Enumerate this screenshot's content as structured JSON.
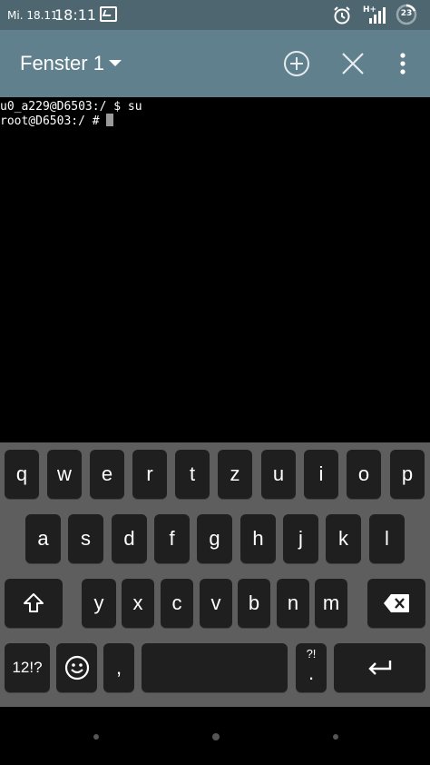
{
  "status_bar": {
    "date": "Mi. 18.11.",
    "time": "18:11",
    "network_type": "H+",
    "battery_level": "23",
    "icons": [
      "terminal-icon",
      "alarm-icon",
      "signal-icon",
      "battery-icon"
    ]
  },
  "app_bar": {
    "window_title": "Fenster 1",
    "icons": [
      "dropdown-arrow-icon",
      "add-window-icon",
      "close-window-icon",
      "more-options-icon"
    ]
  },
  "terminal": {
    "lines": [
      "u0_a229@D6503:/ $ su",
      "root@D6503:/ # "
    ]
  },
  "keyboard": {
    "row1": [
      "q",
      "w",
      "e",
      "r",
      "t",
      "z",
      "u",
      "i",
      "o",
      "p"
    ],
    "row2": [
      "a",
      "s",
      "d",
      "f",
      "g",
      "h",
      "j",
      "k",
      "l"
    ],
    "row3": [
      "y",
      "x",
      "c",
      "v",
      "b",
      "n",
      "m"
    ],
    "symbols_label": "12!?",
    "comma_label": ",",
    "period_label": ".",
    "period_hint": "?!",
    "icons": [
      "shift-icon",
      "backspace-icon",
      "emoji-icon",
      "enter-icon"
    ]
  },
  "colors": {
    "status_bar": "#4d6670",
    "app_bar": "#60808d",
    "keyboard_bg": "#5e5e5e",
    "key_bg": "#1f1f1f"
  }
}
